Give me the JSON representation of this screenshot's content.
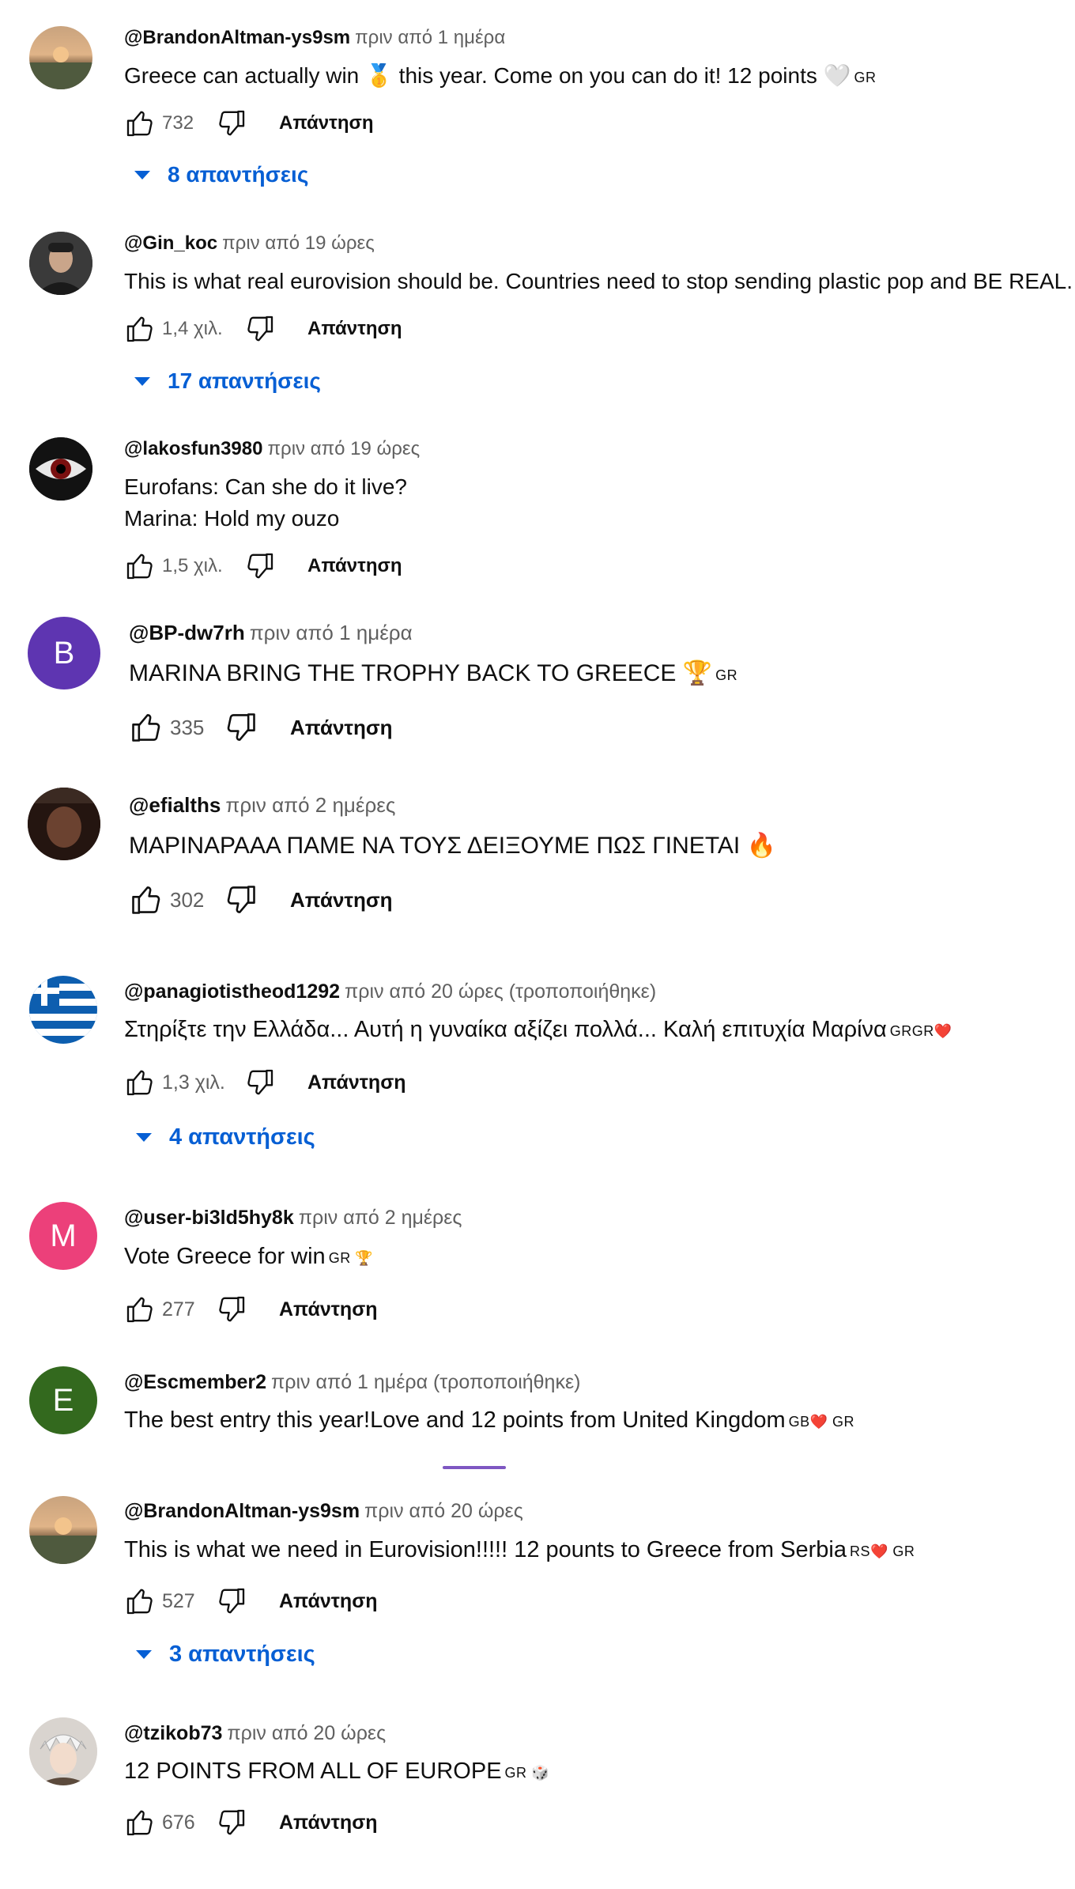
{
  "comments": [
    {
      "author": "@BrandonAltman-ys9sm",
      "time": "πριν από 1 ημέρα",
      "text": "Greece can actually win 🥇 this year. Come on you can do it! 12 points 🤍",
      "flags": "GR",
      "likes": "732",
      "reply": "Απάντηση",
      "replies": "8 απαντήσεις",
      "avatar": {
        "type": "sunset"
      }
    },
    {
      "author": "@Gin_koc",
      "time": "πριν από 19 ώρες",
      "text": "This is what real eurovision should be.  Countries need to stop sending plastic pop and BE REAL.",
      "flags": "",
      "likes": "1,4 χιλ.",
      "reply": "Απάντηση",
      "replies": "17 απαντήσεις",
      "avatar": {
        "type": "person"
      }
    },
    {
      "author": "@lakosfun3980",
      "time": "πριν από 19 ώρες",
      "text": "Eurofans: Can she do it live?\nMarina: Hold my ouzo",
      "flags": "",
      "likes": "1,5 χιλ.",
      "reply": "Απάντηση",
      "replies": "",
      "avatar": {
        "type": "eye"
      }
    },
    {
      "author": "@BP-dw7rh",
      "time": "πριν από 1 ημέρα",
      "text": "MARINA BRING THE TROPHY BACK TO GREECE 🏆",
      "flags": "GR",
      "likes": "335",
      "reply": "Απάντηση",
      "replies": "",
      "avatar": {
        "type": "letter",
        "letter": "B",
        "color": "#5e35b1"
      }
    },
    {
      "author": "@efialths",
      "time": "πριν από 2 ημέρες",
      "text": "ΜΑΡΙΝΑΡΑΑΑ ΠΑΜΕ ΝΑ ΤΟΥΣ ΔΕΙΞΟΥΜΕ ΠΩΣ ΓΙΝΕΤΑΙ 🔥",
      "flags": "",
      "likes": "302",
      "reply": "Απάντηση",
      "replies": "",
      "avatar": {
        "type": "dark"
      }
    },
    {
      "author": "@panagiotistheod1292",
      "time": "πριν από 20 ώρες (τροποποιήθηκε)",
      "text": "Στηρίξτε την Ελλάδα... Αυτή η γυναίκα αξίζει πολλά... Καλή επιτυχία Μαρίνα",
      "flags": "GRGR❤️",
      "likes": "1,3 χιλ.",
      "reply": "Απάντηση",
      "replies": "4 απαντήσεις",
      "avatar": {
        "type": "flag"
      }
    },
    {
      "author": "@user-bi3ld5hy8k",
      "time": "πριν από 2 ημέρες",
      "text": "Vote Greece for win",
      "flags": "GR 🏆",
      "likes": "277",
      "reply": "Απάντηση",
      "replies": "",
      "avatar": {
        "type": "letter",
        "letter": "M",
        "color": "#ec407a"
      }
    },
    {
      "author": "@Escmember2",
      "time": "πριν από 1 ημέρα (τροποποιήθηκε)",
      "text": "The best entry this year!Love and 12 points from United Kingdom",
      "flags": "GB❤️ GR",
      "likes": "",
      "reply": "",
      "replies": "",
      "avatar": {
        "type": "letter",
        "letter": "E",
        "color": "#33691e"
      }
    },
    {
      "author": "@BrandonAltman-ys9sm",
      "time": "πριν από 20 ώρες",
      "text": "This is what we need in Eurovision!!!!! 12 pounts to Greece from Serbia",
      "flags": "RS❤️ GR",
      "likes": "527",
      "reply": "Απάντηση",
      "replies": "3 απαντήσεις",
      "avatar": {
        "type": "sunset"
      }
    },
    {
      "author": "@tzikob73",
      "time": "πριν από 20 ώρες",
      "text": "12 POINTS FROM ALL OF EUROPE",
      "flags": "GR 🎲",
      "likes": "676",
      "reply": "Απάντηση",
      "replies": "",
      "avatar": {
        "type": "anime"
      }
    }
  ],
  "colors": {
    "link": "#065fd4",
    "muted": "#606060",
    "text": "#0f0f0f"
  },
  "icons": {
    "like": "thumbs-up-icon",
    "dislike": "thumbs-down-icon",
    "expand": "caret-down-icon"
  }
}
